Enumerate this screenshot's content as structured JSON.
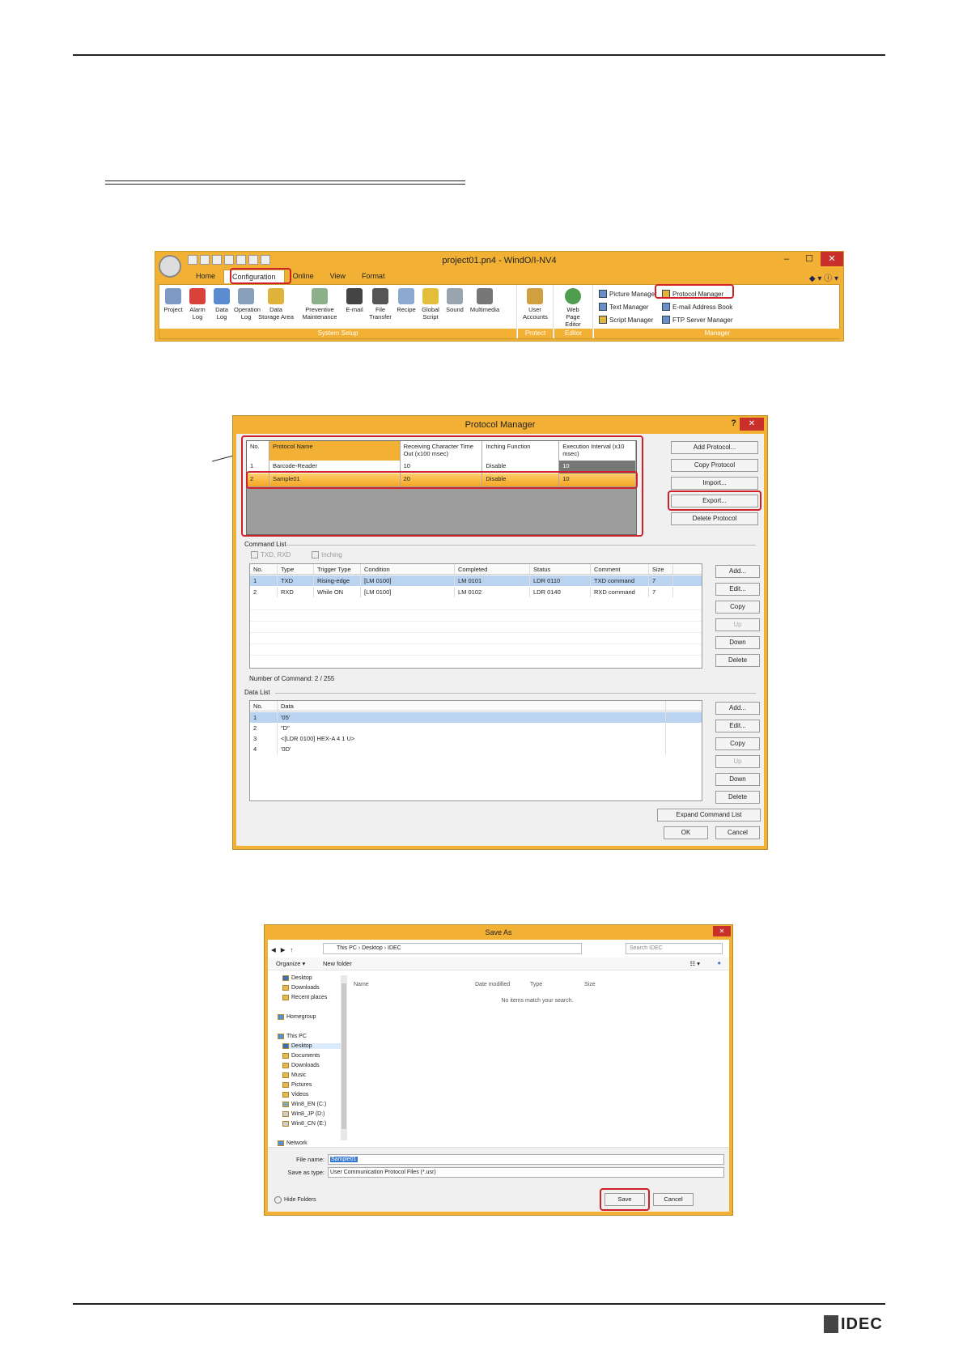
{
  "brand": {
    "logo_text": "IDEC"
  },
  "ribbon": {
    "window_title": "project01.pn4 - WindO/I-NV4",
    "tabs": [
      "Home",
      "Configuration",
      "Online",
      "View",
      "Format"
    ],
    "buttons": [
      "Project",
      "Alarm Log",
      "Data Log",
      "Operation Log",
      "Data Storage Area",
      "Preventive Maintenance",
      "E-mail",
      "File Transfer",
      "Recipe",
      "Global Script",
      "Sound",
      "Multimedia",
      "User Accounts",
      "Web Page Editor"
    ],
    "groups": [
      "System Setup",
      "Protect",
      "Editor",
      "Manager"
    ],
    "managers": [
      "Picture Manager",
      "Protocol Manager",
      "Text Manager",
      "E-mail Address Book",
      "Script Manager",
      "FTP Server Manager"
    ]
  },
  "protocol_manager": {
    "title": "Protocol Manager",
    "help": "?",
    "columns": [
      "No.",
      "Protocol Name",
      "Receiving Character Time Out (x100 msec)",
      "Inching Function",
      "Execution Interval (x10 msec)"
    ],
    "rows": [
      [
        "1",
        "Barcode-Reader",
        "10",
        "Disable",
        "10"
      ],
      [
        "2",
        "Sample01",
        "20",
        "Disable",
        "10"
      ]
    ],
    "side_buttons": [
      "Add Protocol...",
      "Copy Protocol",
      "Import...",
      "Export...",
      "Delete Protocol"
    ],
    "command_list": {
      "label": "Command List",
      "checks": [
        "TXD, RXD",
        "Inching"
      ],
      "columns": [
        "No.",
        "Type",
        "Trigger Type",
        "Condition",
        "Completed",
        "Status",
        "Comment",
        "Size"
      ],
      "rows": [
        [
          "1",
          "TXD",
          "Rising-edge",
          "[LM 0100]",
          "LM 0101",
          "LDR 0110",
          "TXD command",
          "7"
        ],
        [
          "2",
          "RXD",
          "While ON",
          "[LM 0100]",
          "LM 0102",
          "LDR 0140",
          "RXD command",
          "7"
        ]
      ],
      "buttons": [
        "Add...",
        "Edit...",
        "Copy",
        "Up",
        "Down",
        "Delete"
      ],
      "count": "Number of Command: 2 / 255"
    },
    "data_list": {
      "label": "Data List",
      "columns": [
        "No.",
        "Data"
      ],
      "rows": [
        [
          "1",
          "'05'"
        ],
        [
          "2",
          "\"D\""
        ],
        [
          "3",
          "<[LDR 0100] HEX-A 4 1 U>"
        ],
        [
          "4",
          "'0D'"
        ]
      ],
      "buttons": [
        "Add...",
        "Edit...",
        "Copy",
        "Up",
        "Down",
        "Delete"
      ]
    },
    "expand_button": "Expand Command List",
    "ok": "OK",
    "cancel": "Cancel"
  },
  "save_as": {
    "title": "Save As",
    "path": "This PC  ›  Desktop  ›  IDEC",
    "search_placeholder": "Search IDEC",
    "organize": "Organize ▾",
    "new_folder": "New folder",
    "tree": [
      "Desktop",
      "Downloads",
      "Recent places",
      "Homegroup",
      "This PC",
      "Desktop",
      "Documents",
      "Downloads",
      "Music",
      "Pictures",
      "Videos",
      "Win8_EN (C:)",
      "Win8_JP (D:)",
      "Win8_CN (E:)",
      "Network"
    ],
    "columns": [
      "Name",
      "Date modified",
      "Type",
      "Size"
    ],
    "empty_message": "No items match your search.",
    "file_name_label": "File name:",
    "file_name": "Sample01",
    "save_type_label": "Save as type:",
    "save_type": "User Communication Protocol Files (*.usr)",
    "hide_folders": "Hide Folders",
    "save": "Save",
    "cancel": "Cancel"
  }
}
